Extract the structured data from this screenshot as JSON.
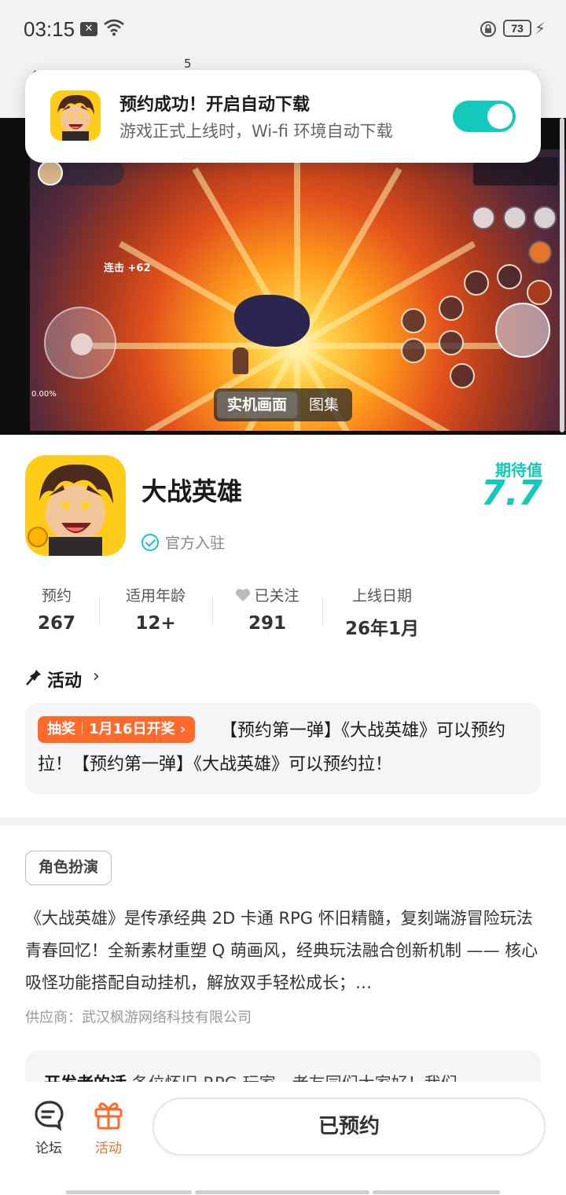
{
  "status_bar": {
    "time": "03:15",
    "battery": "73"
  },
  "header": {
    "badge_number": "5"
  },
  "toast": {
    "title": "预约成功！开启自动下载",
    "subtitle": "游戏正式上线时，Wi-fi 环境自动下载",
    "toggle_on": true
  },
  "media": {
    "tabs": [
      "实机画面",
      "图集"
    ],
    "active_tab": "实机画面",
    "hud_combo": "连击 +62",
    "hud_percent": "0.00%"
  },
  "game": {
    "name": "大战英雄",
    "official_label": "官方入驻",
    "expect_label": "期待值",
    "expect_score": "7.7"
  },
  "stats": [
    {
      "label": "预约",
      "value": "267"
    },
    {
      "label": "适用年龄",
      "value": "12+"
    },
    {
      "label": "已关注",
      "value": "291"
    },
    {
      "label": "上线日期",
      "value": "26年1月"
    }
  ],
  "activity": {
    "title": "活动",
    "badge_type": "抽奖",
    "badge_date": "1月16日开奖",
    "text": "【预约第一弹】《大战英雄》可以预约拉！【预约第一弹】《大战英雄》可以预约拉！"
  },
  "detail": {
    "genre": "角色扮演",
    "description": "《大战英雄》是传承经典 2D 卡通 RPG 怀旧精髓，复刻端游冒险玩法青春回忆！全新素材重塑 Q 萌画风，经典玩法融合创新机制 —— 核心吸怪功能搭配自动挂机，解放双手轻松成长；…",
    "supplier": "供应商：武汉枫游网络科技有限公司",
    "dev_label": "开发者的话",
    "dev_text": "各位怀旧 RPG 玩家，老友同们大家好！我们"
  },
  "bottom_nav": {
    "forum": "论坛",
    "activity": "活动",
    "reserved_button": "已预约"
  },
  "colors": {
    "accent": "#12c9bc",
    "orange": "#ff6a2a"
  }
}
